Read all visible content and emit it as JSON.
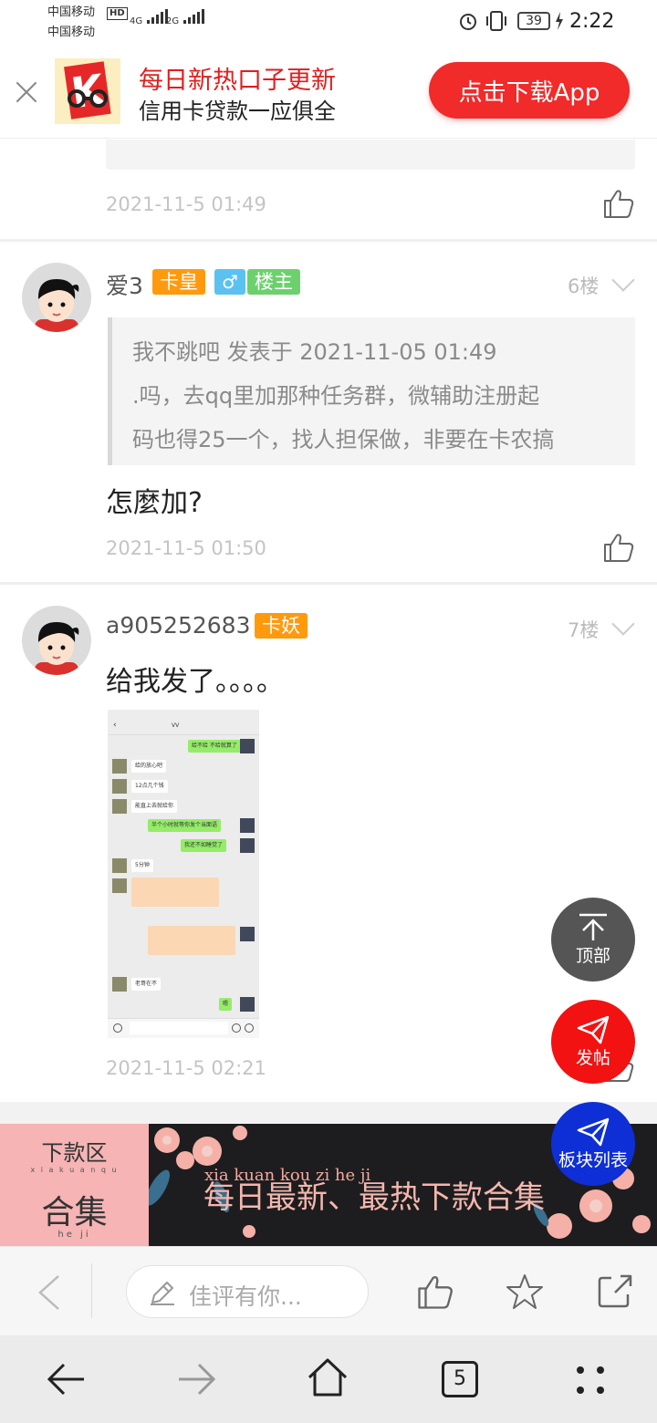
{
  "status_bar": {
    "carrier1": "中国移动",
    "carrier2": "中国移动",
    "hd_badge": "HD",
    "net1": "4G",
    "net2": "2G",
    "battery": "39",
    "time": "2:22"
  },
  "ad_bar": {
    "title": "每日新热口子更新",
    "subtitle": "信用卡贷款一应俱全",
    "download_button": "点击下载App",
    "logo_letter": "K"
  },
  "posts": [
    {
      "timestamp": "2021-11-5 01:49"
    },
    {
      "username": "爱3",
      "badges": [
        "卡皇",
        "♂",
        "楼主"
      ],
      "floor": "6楼",
      "quote": {
        "header": "我不跳吧 发表于 2021-11-05 01:49",
        "line1": ".吗，去qq里加那种任务群，微辅助注册起",
        "line2": "码也得25一个，找人担保做，非要在卡农搞"
      },
      "text": "怎麼加?",
      "timestamp": "2021-11-5 01:50"
    },
    {
      "username": "a905252683",
      "badges": [
        "卡妖"
      ],
      "floor": "7楼",
      "text": "给我发了。。。。",
      "timestamp": "2021-11-5 02:21"
    }
  ],
  "chat_thumbnail": {
    "title": "VV",
    "messages": [
      {
        "side": "right",
        "text": "给不给 不给就算了"
      },
      {
        "side": "left",
        "text": "给的放心吧"
      },
      {
        "side": "left",
        "text": "12点几个钱"
      },
      {
        "side": "left",
        "text": "能直上去就给你"
      },
      {
        "side": "right",
        "text": "半个小时就等你发个当面语"
      },
      {
        "side": "right",
        "text": "我还不如睡觉了"
      },
      {
        "side": "left",
        "text": "5分钟"
      },
      {
        "side": "left",
        "text": "老哥在不"
      },
      {
        "side": "right",
        "text": "嗯"
      }
    ]
  },
  "fab": {
    "top": "顶部",
    "post": "发帖",
    "board_list": "板块列表"
  },
  "banner": {
    "left_title": "下款区",
    "left_pinyin": "x i a k u a n q u",
    "left_main": "合集",
    "left_pinyin2": "he ji",
    "right_pinyin": "xia kuan kou zi he ji",
    "right_main": "每日最新、最热下款合集"
  },
  "action_bar": {
    "comment_placeholder": "佳评有你..."
  },
  "nav_bar": {
    "tabs_count": "5"
  },
  "colors": {
    "accent_red": "#f12a2a",
    "badge_orange": "#ff9a0e",
    "badge_blue": "#5bc2f0",
    "badge_green": "#6cd16c",
    "fab_gray": "#555555",
    "fab_blue": "#0e2fd6"
  }
}
